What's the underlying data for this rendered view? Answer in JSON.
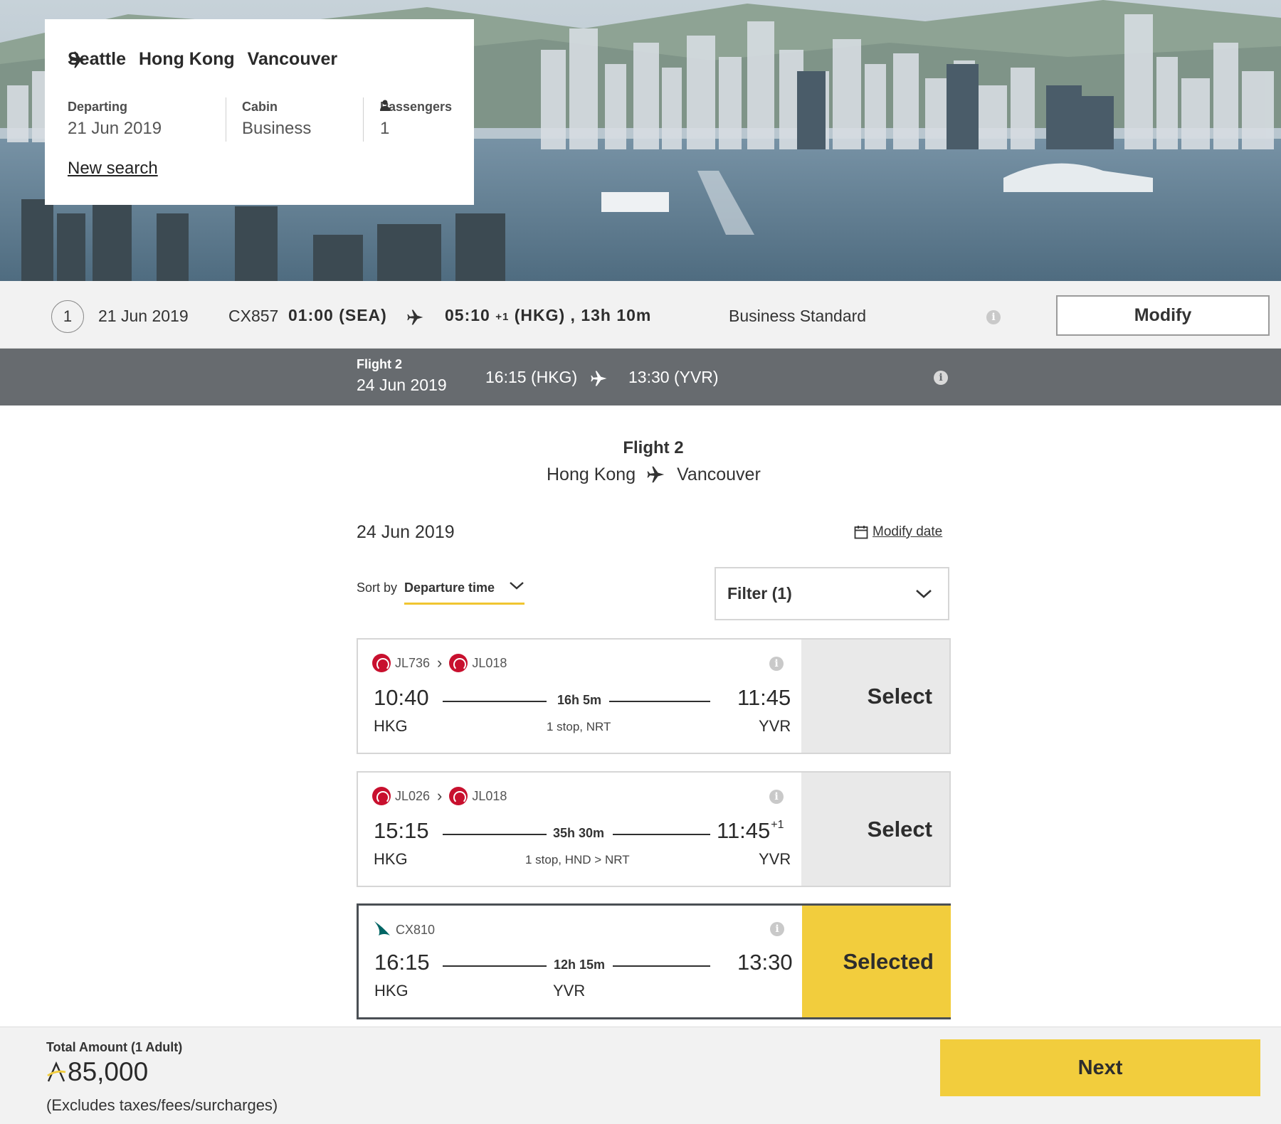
{
  "search": {
    "route": [
      "Seattle",
      "Hong Kong",
      "Vancouver"
    ],
    "departing_label": "Departing",
    "departing_value": "21 Jun 2019",
    "cabin_label": "Cabin",
    "cabin_value": "Business",
    "passengers_label": "Passengers",
    "passengers_value": "1",
    "new_search": "New search"
  },
  "flight1": {
    "step": "1",
    "date": "21 Jun 2019",
    "flight_no": "CX857",
    "departure": "01:00 (SEA)",
    "arrival_time": "05:10",
    "arrival_plus": "+1",
    "arrival_rest": "(HKG) , 13h 10m",
    "cabin": "Business Standard",
    "modify": "Modify"
  },
  "flight2_bar": {
    "label": "Flight 2",
    "date": "24 Jun 2019",
    "departure": "16:15 (HKG)",
    "arrival": "13:30 (YVR)"
  },
  "section": {
    "title": "Flight 2",
    "origin": "Hong Kong",
    "destination": "Vancouver",
    "date": "24 Jun 2019",
    "modify_date": "Modify date",
    "sort_label": "Sort by",
    "sort_value": "Departure time",
    "filter": "Filter (1)"
  },
  "flights": [
    {
      "segments": [
        "JL736",
        "JL018"
      ],
      "dep_time": "10:40",
      "dep_airport": "HKG",
      "duration": "16h 5m",
      "stops": "1 stop, NRT",
      "arr_time": "11:45",
      "arr_plus": "",
      "arr_airport": "YVR",
      "action": "Select"
    },
    {
      "segments": [
        "JL026",
        "JL018"
      ],
      "dep_time": "15:15",
      "dep_airport": "HKG",
      "duration": "35h 30m",
      "stops": "1 stop, HND > NRT",
      "arr_time": "11:45",
      "arr_plus": "+1",
      "arr_airport": "YVR",
      "action": "Select"
    },
    {
      "segments": [
        "CX810"
      ],
      "dep_time": "16:15",
      "dep_airport": "HKG",
      "duration": "12h 15m",
      "stops": "YVR",
      "arr_time": "13:30",
      "arr_plus": "",
      "action": "Selected"
    }
  ],
  "footer": {
    "total_label": "Total Amount (1 Adult)",
    "total_value": "85,000",
    "note": "(Excludes taxes/fees/surcharges)",
    "next": "Next"
  },
  "colors": {
    "accent_yellow": "#f2cd3d",
    "dark_bar": "#676b6f",
    "jal_red": "#c8102e",
    "cathay_teal": "#006564"
  },
  "icons": [
    "plane-icon",
    "info-icon",
    "person-icon",
    "calendar-icon",
    "chevron-down-icon",
    "jal-logo-icon",
    "cathay-logo-icon",
    "asia-miles-icon"
  ]
}
